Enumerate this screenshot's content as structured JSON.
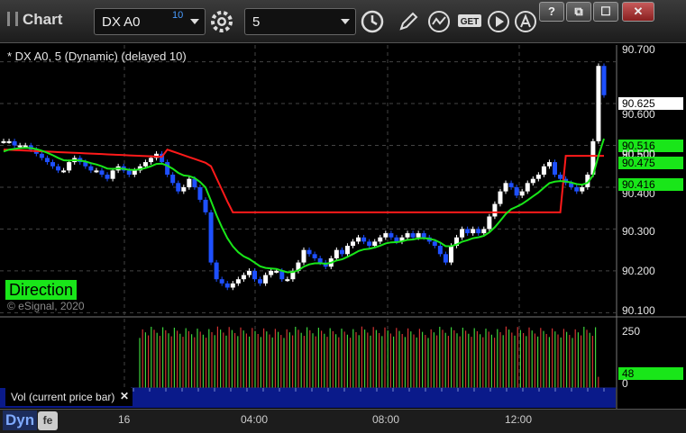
{
  "app": {
    "title": "Chart",
    "symbol": "DX A0",
    "symbol_superscript": "10",
    "interval": "5",
    "window_buttons": [
      "?",
      "⧉",
      "☐",
      "✕"
    ]
  },
  "toolbar": {
    "icons": [
      "settings-icon",
      "clock-icon",
      "pencil-icon",
      "study-icon",
      "get-icon",
      "play-icon",
      "alert-icon"
    ],
    "get_label": "GET"
  },
  "chart": {
    "title": "* DX A0, 5 (Dynamic) (delayed 10)",
    "badge": "Direction",
    "copyright": "© eSignal, 2020",
    "price_ticks": [
      "90.700",
      "90.600",
      "90.500",
      "90.400",
      "90.300",
      "90.200",
      "90.100"
    ],
    "price_tags": [
      {
        "label": "90.625",
        "bg": "#ffffff",
        "fg": "#000000"
      },
      {
        "label": "90.516",
        "bg": "#19e619",
        "fg": "#000000"
      },
      {
        "label": "90.475",
        "bg": "#19e619",
        "fg": "#000000"
      },
      {
        "label": "90.416",
        "bg": "#19e619",
        "fg": "#000000"
      }
    ],
    "hidden_tag_label": "90.500",
    "colors": {
      "up": "#ffffff",
      "down": "#1e50ff",
      "red_line": "#ff1a1a",
      "green_line": "#19e619"
    }
  },
  "volume": {
    "label": "Vol (current price bar)",
    "close": "✕",
    "ticks": [
      "250",
      "0"
    ],
    "current": "48"
  },
  "time_axis": {
    "labels": [
      "16",
      "04:00",
      "08:00",
      "12:00"
    ]
  },
  "status": {
    "mode": "Dyn",
    "mode_icon": "fe"
  },
  "chart_data": {
    "type": "candlestick",
    "title": "* DX A0, 5 (Dynamic) (delayed 10)",
    "ylim": [
      90.09,
      90.74
    ],
    "yticks": [
      90.7,
      90.6,
      90.5,
      90.4,
      90.3,
      90.2,
      90.1
    ],
    "x_labels": [
      "16",
      "04:00",
      "08:00",
      "12:00"
    ],
    "close_series": [
      90.51,
      90.51,
      90.5,
      90.5,
      90.5,
      90.49,
      90.48,
      90.47,
      90.46,
      90.45,
      90.44,
      90.44,
      90.46,
      90.47,
      90.46,
      90.45,
      90.44,
      90.44,
      90.43,
      90.42,
      90.44,
      90.45,
      90.44,
      90.43,
      90.44,
      90.45,
      90.46,
      90.47,
      90.48,
      90.46,
      90.43,
      90.41,
      90.39,
      90.4,
      90.42,
      90.4,
      90.37,
      90.34,
      90.22,
      90.18,
      90.17,
      90.16,
      90.17,
      90.18,
      90.19,
      90.2,
      90.18,
      90.17,
      90.19,
      90.2,
      90.2,
      90.18,
      90.18,
      90.2,
      90.22,
      90.25,
      90.24,
      90.23,
      90.22,
      90.21,
      90.23,
      90.25,
      90.24,
      90.26,
      90.27,
      90.28,
      90.27,
      90.26,
      90.27,
      90.28,
      90.29,
      90.28,
      90.27,
      90.28,
      90.29,
      90.28,
      90.29,
      90.28,
      90.27,
      90.26,
      90.24,
      90.22,
      90.26,
      90.28,
      90.3,
      90.29,
      90.3,
      90.29,
      90.3,
      90.33,
      90.36,
      90.39,
      90.41,
      90.4,
      90.38,
      90.39,
      90.41,
      90.42,
      90.43,
      90.45,
      90.46,
      90.43,
      90.42,
      90.41,
      90.4,
      90.39,
      90.4,
      90.43,
      90.51,
      90.69,
      90.62
    ],
    "red_line": {
      "start": 90.49,
      "step_level": 90.34,
      "end_level": 90.475
    },
    "green_line": {
      "start": 90.48,
      "end": 90.516
    },
    "volume": {
      "ylim": [
        0,
        290
      ],
      "yticks": [
        250,
        0
      ],
      "current": 48
    }
  }
}
